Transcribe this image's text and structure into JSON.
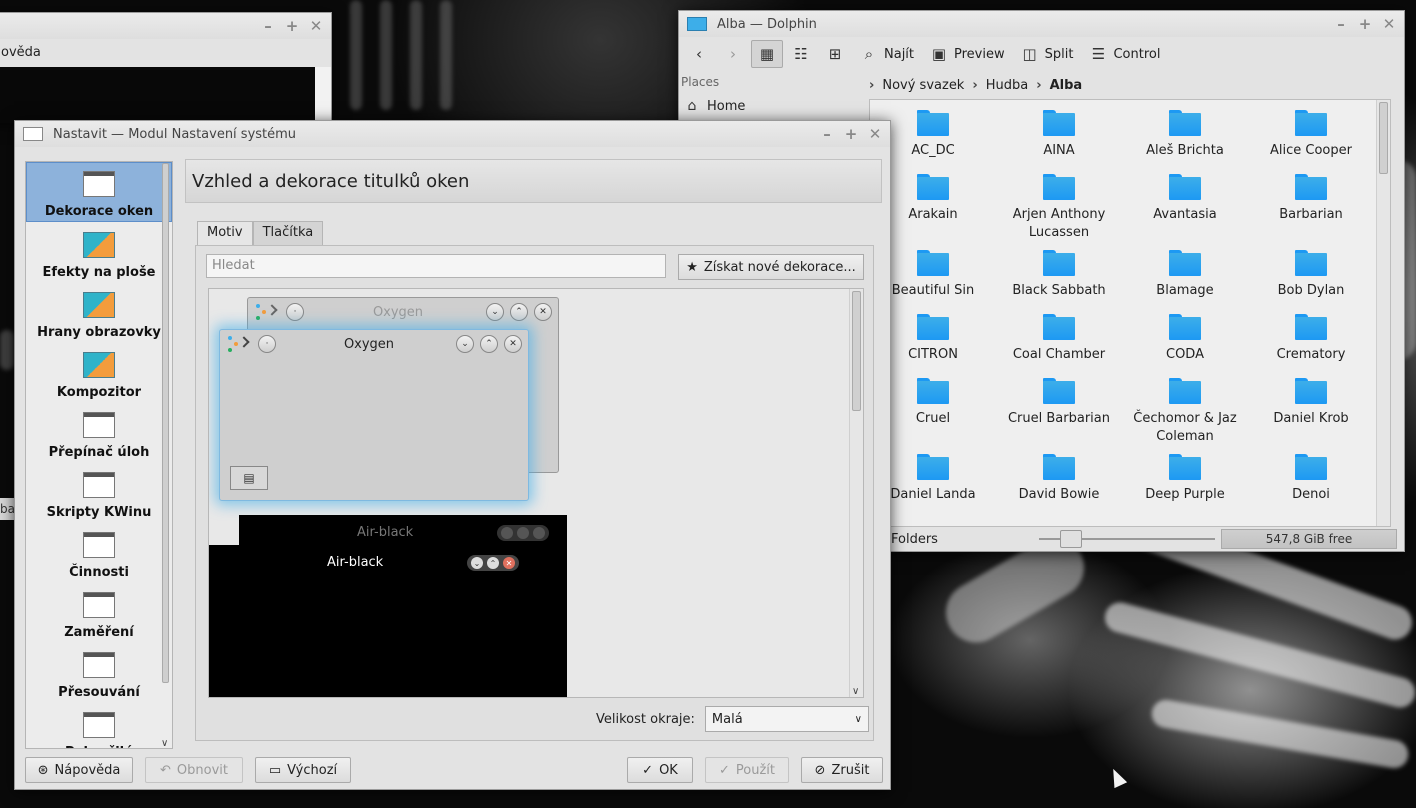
{
  "background_window": {
    "menu_text": "ovědа",
    "side_label": "ba"
  },
  "dolphin": {
    "title": "Alba — Dolphin",
    "toolbar": {
      "find": "Najít",
      "preview": "Preview",
      "split": "Split",
      "control": "Control"
    },
    "places": {
      "header": "Places",
      "items": [
        "Home"
      ]
    },
    "breadcrumb": [
      "Nový svazek",
      "Hudba",
      "Alba"
    ],
    "folders": [
      "AC_DC",
      "AINA",
      "Aleš Brichta",
      "Alice Cooper",
      "Arakain",
      "Arjen Anthony Lucassen",
      "Avantasia",
      "Barbarian",
      "Beautiful Sin",
      "Black Sabbath",
      "Blamage",
      "Bob Dylan",
      "CITRON",
      "Coal Chamber",
      "CODA",
      "Crematory",
      "Cruel",
      "Cruel Barbarian",
      "Čechomor & Jaz Coleman",
      "Daniel Krob",
      "Daniel Landa",
      "David Bowie",
      "Deep Purple",
      "Denoi"
    ],
    "status": {
      "label": "Folders",
      "free_space": "547,8 GiB free",
      "zoom_level": 0.12
    }
  },
  "settings": {
    "title": "Nastavit — Modul Nastavení systému",
    "sidebar": [
      {
        "label": "Dekorace oken",
        "icon": "window-icon",
        "selected": true
      },
      {
        "label": "Efekty na ploše",
        "icon": "desktop-effects-icon"
      },
      {
        "label": "Hrany obrazovky",
        "icon": "screen-edges-icon"
      },
      {
        "label": "Kompozitor",
        "icon": "compositor-icon"
      },
      {
        "label": "Přepínač úloh",
        "icon": "task-switcher-icon"
      },
      {
        "label": "Skripty KWinu",
        "icon": "kwin-scripts-icon"
      },
      {
        "label": "Činnosti",
        "icon": "activities-icon"
      },
      {
        "label": "Zaměření",
        "icon": "focus-icon"
      },
      {
        "label": "Přesouvání",
        "icon": "moving-icon"
      },
      {
        "label": "Pokročilé",
        "icon": "advanced-icon"
      }
    ],
    "header": "Vzhled a dekorace titulků oken",
    "tabs": [
      "Motiv",
      "Tlačítka"
    ],
    "search_placeholder": "Hledat",
    "get_new_button": "Získat nové dekorace...",
    "themes": {
      "oxygen_inactive": "Oxygen",
      "oxygen_active": "Oxygen",
      "air_inactive": "Air-black",
      "air_active": "Air-black"
    },
    "border_size_label": "Velikost okraje:",
    "border_size_value": "Malá",
    "buttons": {
      "help": "Nápověda",
      "reset": "Obnovit",
      "defaults": "Výchozí",
      "ok": "OK",
      "apply": "Použít",
      "cancel": "Zrušit"
    }
  }
}
